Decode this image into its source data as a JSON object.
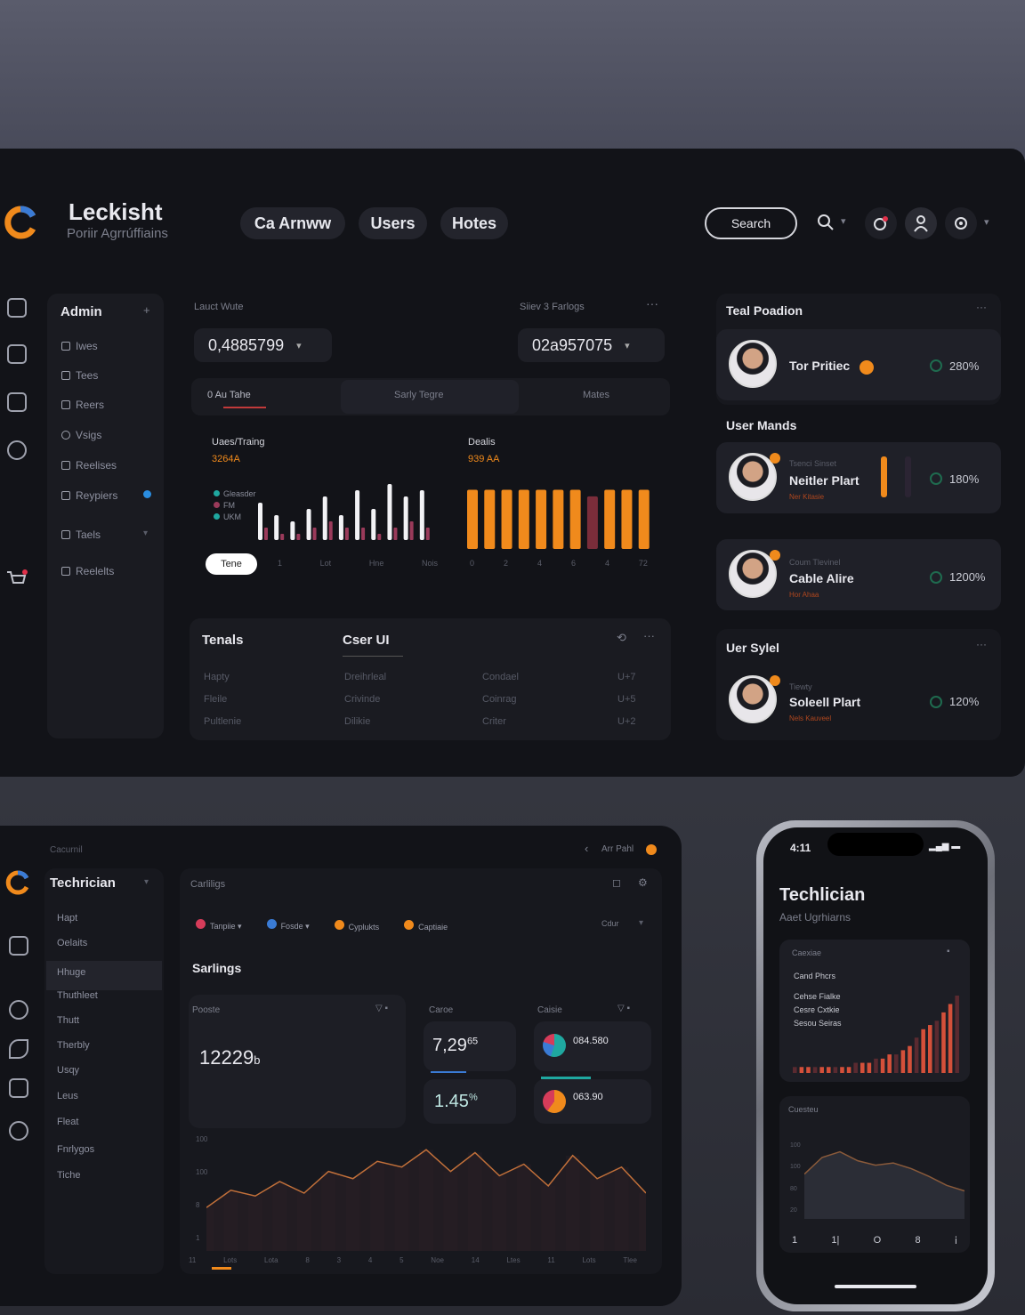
{
  "colors": {
    "accent": "#f08a1c",
    "bg": "#131419",
    "card": "#1d1e25",
    "teal": "#1fa8a0",
    "bar_red": "#7a2d3a"
  },
  "header": {
    "brand": "Leckisht",
    "brand_sub": "Poriir Agrrúffiains",
    "tabs": [
      "Ca Arnww",
      "Users",
      "Hotes"
    ],
    "search_label": "Search",
    "icons": [
      "search-icon",
      "bell-icon",
      "user-icon",
      "settings-icon"
    ]
  },
  "sidebar": {
    "title": "Admin",
    "items": [
      {
        "label": "Iwes",
        "icon": "list-icon"
      },
      {
        "label": "Tees",
        "icon": "grid-icon"
      },
      {
        "label": "Reers",
        "icon": "doc-icon"
      },
      {
        "label": "Vsigs",
        "icon": "gear-icon"
      },
      {
        "label": "Reelises",
        "icon": "page-icon"
      },
      {
        "label": "Reypiers",
        "icon": "calendar-icon"
      },
      {
        "label": "Taels",
        "icon": "book-icon"
      },
      {
        "label": "Reelelts",
        "icon": "chart-icon"
      }
    ]
  },
  "main": {
    "label_left": "Lauct Wute",
    "label_right": "Siiev 3 Farlogs",
    "select_left": "0,4885799",
    "select_right": "02a957075",
    "tabs": [
      "0  Au Tahe",
      "Sarly Tegre",
      "Mates"
    ],
    "chart_left": {
      "title": "Uaes/Traing",
      "value": "3264A",
      "legend": [
        "Gleasder",
        "FM",
        "UKM"
      ],
      "ticks": [
        "1",
        "Lot",
        "Hne",
        "Nois"
      ],
      "button": "Tene"
    },
    "chart_right": {
      "title": "Dealis",
      "value": "939 AA",
      "ticks": [
        "0",
        "2",
        "4",
        "6",
        "4",
        "72"
      ]
    }
  },
  "chart_data": [
    {
      "type": "bar",
      "title": "Uaes/Traing",
      "series": [
        {
          "name": "Gleasder",
          "values": [
            6,
            4,
            3,
            5,
            7,
            4,
            8,
            5,
            9,
            7,
            8
          ]
        },
        {
          "name": "FM",
          "values": [
            2,
            1,
            1,
            2,
            3,
            2,
            2,
            1,
            2,
            3,
            2
          ]
        }
      ]
    },
    {
      "type": "bar",
      "title": "Dealis",
      "series": [
        {
          "values": [
            9,
            9,
            9,
            9,
            9,
            9,
            9,
            8,
            9,
            9,
            9
          ]
        }
      ]
    },
    {
      "type": "area",
      "title": "Sarlings",
      "ylabel": "",
      "values": [
        30,
        42,
        38,
        48,
        40,
        55,
        50,
        62,
        58,
        70,
        55,
        68,
        52,
        60,
        45,
        66,
        50,
        58,
        40
      ]
    },
    {
      "type": "bar",
      "title": "",
      "values": [
        1,
        1,
        1,
        1,
        1,
        1,
        1,
        1,
        1,
        2,
        2,
        2,
        3,
        3,
        4,
        4,
        5,
        6,
        8,
        10,
        11,
        12,
        14,
        16,
        18
      ]
    },
    {
      "type": "area",
      "title": "Cuesteu",
      "values": [
        40,
        55,
        60,
        52,
        48,
        50,
        45,
        38,
        30,
        25
      ]
    }
  ],
  "table": {
    "title": "Tenals",
    "title2": "Cser UI",
    "rows": [
      [
        "Hapty",
        "Dreihrleal",
        "Condael",
        "U+7"
      ],
      [
        "Fleile",
        "Crivinde",
        "Coinrag",
        "U+5"
      ],
      [
        "Pultlenie",
        "Dilikie",
        "Criter",
        "U+2"
      ]
    ]
  },
  "right": {
    "title1": "Teal Poadion",
    "title2": "User Mands",
    "title3": "Uer Sylel",
    "people": [
      {
        "name": "Tor Pritiec",
        "sub": "",
        "tag": "",
        "pct": "280%"
      },
      {
        "name": "Neitler Plart",
        "sub": "Tsenci Sinset",
        "tag": "Ner Kitasie",
        "pct": "180%"
      },
      {
        "name": "Cable Alire",
        "sub": "Coum Tlevinel",
        "tag": "Hor Ahaa",
        "pct": "1200%"
      },
      {
        "name": "Soleell Plart",
        "sub": "Tiewty",
        "tag": "Nels Kauveel",
        "pct": "120%"
      }
    ]
  },
  "tablet": {
    "crumb": "Cacurnil",
    "top_right": "Arr Pahl",
    "brand": "Techrician",
    "menu": [
      "Hapt",
      "Oelaits",
      "Hhuge",
      "Thuthleet",
      "Thutt",
      "Therbly",
      "Usqy",
      "Leus",
      "Fleat",
      "Fnrlygos",
      "Tiche"
    ],
    "panel_title": "Carliligs",
    "chips": [
      "Tanpiie",
      "Fosde",
      "Cyplukts",
      "Captiaie"
    ],
    "chip_right": "Cdur",
    "section": "Sarlings",
    "card1_label": "Pooste",
    "card1_value": "12229",
    "card1_unit": "b",
    "card2_label": "Caroe",
    "card2_v1": "7,29",
    "card2_v1_sup": "65",
    "card2_v2": "1.45",
    "card2_v2_sup": "%",
    "card3_label": "Caisie",
    "card3_v1": "084.580",
    "card3_v2": "063.90",
    "axis_y": [
      "100",
      "100",
      "8",
      "1"
    ],
    "axis_x": [
      "11",
      "Lots",
      "Lota",
      "8",
      "3",
      "4",
      "5",
      "Noe",
      "14",
      "Ltes",
      "11",
      "Lots",
      "Tlee"
    ]
  },
  "phone": {
    "time": "4:11",
    "title": "Techlician",
    "sub": "Aaet Ugrhiarns",
    "card1_label": "Caexiae",
    "card1_lines": [
      "Cand Phcrs",
      "Cehse Fialke",
      "Cesre Cxtkie",
      "Sesou Seiras"
    ],
    "card2_label": "Cuesteu",
    "axis_y": [
      "100",
      "100",
      "80",
      "20"
    ],
    "dock": [
      "1",
      "1|",
      "O",
      "8",
      "ⅰ"
    ]
  }
}
